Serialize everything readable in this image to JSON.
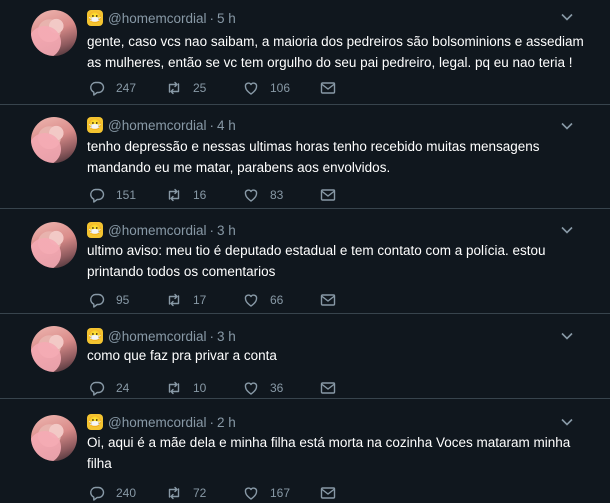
{
  "tweets": [
    {
      "handle": "@homemcordial",
      "time": "5 h",
      "text": "gente, caso vcs nao saibam, a maioria dos pedreiros são bolsominions e assediam as mulheres, então se vc tem orgulho do seu pai pedreiro, legal. pq eu nao teria !",
      "replies": "247",
      "retweets": "25",
      "likes": "106"
    },
    {
      "handle": "@homemcordial",
      "time": "4 h",
      "text": "tenho depressão e nessas ultimas horas tenho recebido muitas mensagens mandando eu me matar, parabens aos envolvidos.",
      "replies": "151",
      "retweets": "16",
      "likes": "83"
    },
    {
      "handle": "@homemcordial",
      "time": "3 h",
      "text": "ultimo aviso: meu tio é deputado estadual e tem contato com a polícia. estou printando todos os comentarios",
      "replies": "95",
      "retweets": "17",
      "likes": "66"
    },
    {
      "handle": "@homemcordial",
      "time": "3 h",
      "text": "como que faz pra privar a conta",
      "replies": "24",
      "retweets": "10",
      "likes": "36"
    },
    {
      "handle": "@homemcordial",
      "time": "2 h",
      "text": "Oi, aqui é a mãe dela e minha filha está morta na cozinha Voces mataram minha filha",
      "replies": "240",
      "retweets": "72",
      "likes": "167"
    }
  ],
  "colors": {
    "background": "#10171e",
    "muted": "#8899a6",
    "divider": "#38444d",
    "badge": "#f4c430"
  },
  "icons": [
    "reply-icon",
    "retweet-icon",
    "like-icon",
    "message-icon",
    "chevron-down-icon",
    "emoji-badge-icon"
  ]
}
